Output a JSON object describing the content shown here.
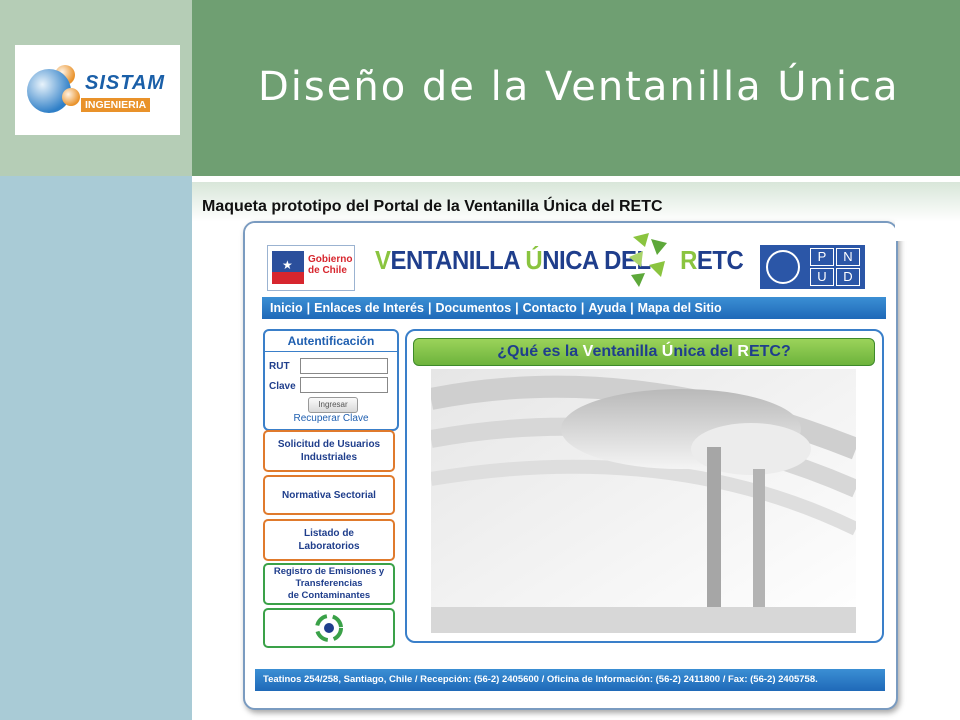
{
  "slide": {
    "title": "Diseño de la Ventanilla Única",
    "subtitle": "Maqueta prototipo del Portal de la Ventanilla Única del RETC"
  },
  "company_logo": {
    "name": "SISTAM",
    "tagline": "INGENIERIA"
  },
  "portal": {
    "gobierno_logo": {
      "line1": "Gobierno",
      "line2": "de Chile"
    },
    "banner_title": {
      "part1_green": "V",
      "part1": "ENTANILLA ",
      "part2_green": "Ú",
      "part2": "NICA DEL",
      "part3_green": "R",
      "part3": "ETC"
    },
    "pnud_logo": [
      "P",
      "N",
      "U",
      "D"
    ],
    "nav": [
      "Inicio",
      "Enlaces de Interés",
      "Documentos",
      "Contacto",
      "Ayuda",
      "Mapa del Sitio"
    ],
    "nav_separator": "|",
    "auth": {
      "title": "Autentificación",
      "rut_label": "RUT",
      "clave_label": "Clave",
      "button": "Ingresar",
      "recover_link": "Recuperar Clave"
    },
    "menu": [
      {
        "line1": "Solicitud de Usuarios",
        "line2": "Industriales"
      },
      {
        "line1": "Normativa Sectorial",
        "line2": ""
      },
      {
        "line1": "Listado de",
        "line2": "Laboratorios"
      },
      {
        "line1": "Registro de Emisiones y",
        "line2": "Transferencias",
        "line3": "de Contaminantes"
      }
    ],
    "main_banner": {
      "p1": "¿Q",
      "p1g": "",
      "p2": "ué es la ",
      "p2g": "V",
      "p3": "entanilla ",
      "p3g": "Ú",
      "p4": "nica del ",
      "p4g": "R",
      "p5": "ETC?"
    },
    "footer": "Teatinos 254/258, Santiago, Chile / Recepción: (56-2) 2405600 / Oficina de Información: (56-2) 2411800 / Fax: (56-2) 2405758."
  },
  "colors": {
    "header_green": "#6f9f72",
    "left_blue": "#a9cbd6",
    "nav_blue": "#1f69b8",
    "accent_green": "#8ac43f",
    "menu_orange": "#e07a2c"
  }
}
